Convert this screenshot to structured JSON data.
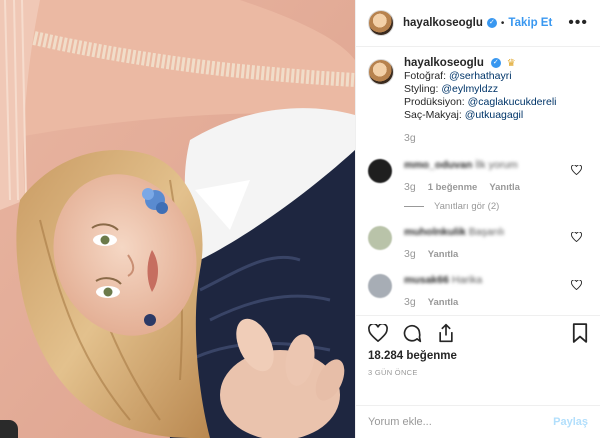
{
  "post": {
    "username": "hayalkoseoglu",
    "follow_label": "Takip Et",
    "dot": "•",
    "more": "•••"
  },
  "caption": {
    "username": "hayalkoseoglu",
    "crown_icon": "crown-icon",
    "lines": [
      {
        "label": "Fotoğraf:",
        "mention": "@serhathayri"
      },
      {
        "label": "Styling:",
        "mention": "@eylmyldzz"
      },
      {
        "label": "Prodüksiyon:",
        "mention": "@caglakucukdereli"
      },
      {
        "label": "Saç-Makyaj:",
        "mention": "@utkuagagil"
      }
    ],
    "time": "3g"
  },
  "comments": [
    {
      "user": "mmo_oduvan",
      "text": "İlk yorum",
      "time": "3g",
      "likes": "1 beğenme",
      "reply": "Yanıtla",
      "view_replies": "Yanıtları gör (2)",
      "avatar_color": "#1f1f1f"
    },
    {
      "user": "muholnkulik",
      "text": "Başarılı",
      "time": "3g",
      "reply": "Yanıtla",
      "avatar_color": "#b9c3a9"
    },
    {
      "user": "musak66",
      "text": "Harika",
      "time": "3g",
      "reply": "Yanıtla",
      "avatar_color": "#a7adb5"
    }
  ],
  "actions": {
    "likes": "18.284 beğenme",
    "ago": "3 GÜN ÖNCE"
  },
  "add_comment": {
    "placeholder": "Yorum ekle...",
    "post_label": "Paylaş"
  },
  "colors": {
    "link": "#3897f0",
    "mention": "#003569",
    "muted": "#999999"
  }
}
